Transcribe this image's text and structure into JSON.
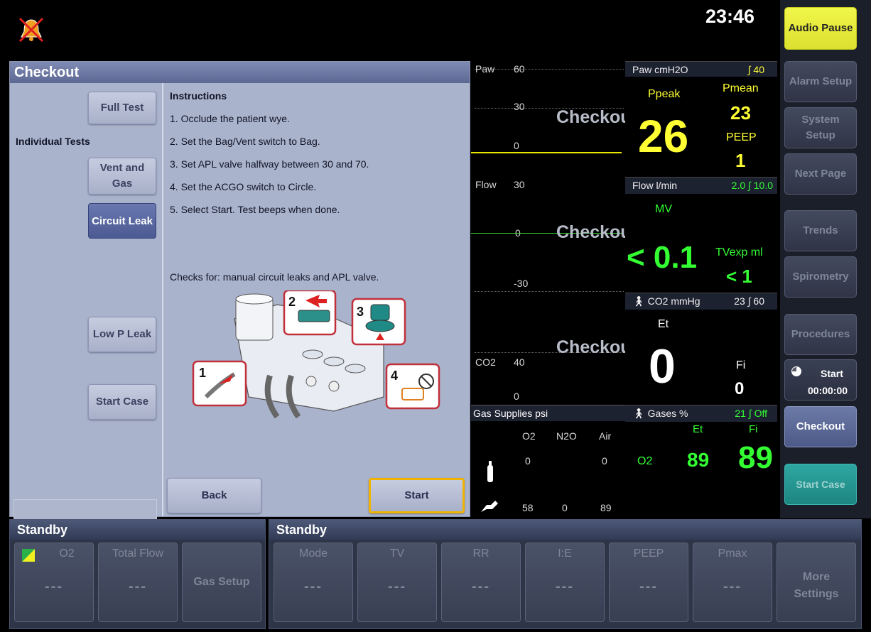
{
  "clock": "23:46",
  "checkout": {
    "title": "Checkout",
    "full_test": "Full Test",
    "individual_tests": "Individual Tests",
    "vent_and_gas": "Vent and Gas",
    "circuit_leak": "Circuit Leak",
    "low_p_leak": "Low P Leak",
    "start_case": "Start Case",
    "instructions_title": "Instructions",
    "steps": [
      "1. Occlude the patient wye.",
      "2. Set the Bag/Vent switch to Bag.",
      "3. Set APL valve halfway between 30 and 70.",
      "4. Set the ACGO switch to Circle.",
      "5. Select Start. Test beeps when done."
    ],
    "checks_for": "Checks for: manual circuit leaks and APL valve.",
    "diagram_numbers": [
      "1",
      "2",
      "3",
      "4"
    ],
    "back": "Back",
    "start": "Start"
  },
  "waves": {
    "paw_label": "Paw",
    "paw_scale": [
      "60",
      "30",
      "0"
    ],
    "flow_label": "Flow",
    "flow_scale": [
      "30",
      "0",
      "-30"
    ],
    "co2_label": "CO2",
    "co2_scale": [
      "40",
      "0"
    ],
    "overlay": "Checkout"
  },
  "gas_supplies": {
    "title": "Gas Supplies psi",
    "cols": [
      "O2",
      "N2O",
      "Air"
    ],
    "cyl_row": [
      "0",
      "",
      "0"
    ],
    "pipe_row": [
      "58",
      "0",
      "89"
    ]
  },
  "paw": {
    "header": "Paw cmH2O",
    "limit": "∫ 40",
    "ppeak_label": "Ppeak",
    "ppeak": "26",
    "pmean_label": "Pmean",
    "pmean": "23",
    "peep_label": "PEEP",
    "peep": "1"
  },
  "flow": {
    "header": "Flow l/min",
    "limit": "2.0 ∫ 10.0",
    "mv_label": "MV",
    "mv": "< 0.1",
    "tvexp_label": "TVexp ml",
    "tvexp": "< 1"
  },
  "co2": {
    "header": "CO2 mmHg",
    "limit": "23 ∫ 60",
    "et_label": "Et",
    "et": "0",
    "fi_label": "Fi",
    "fi": "0"
  },
  "gases": {
    "header": "Gases %",
    "limit": "21 ∫ Off",
    "et_label": "Et",
    "fi_label": "Fi",
    "o2_label": "O2",
    "o2_et": "89",
    "o2_fi": "89"
  },
  "right_buttons": {
    "audio_pause": "Audio Pause",
    "alarm_setup": "Alarm Setup",
    "system_setup": "System Setup",
    "next_page": "Next Page",
    "trends": "Trends",
    "spirometry": "Spirometry",
    "procedures": "Procedures",
    "timer_label": "Start",
    "timer_value": "00:00:00",
    "checkout": "Checkout",
    "start_case": "Start Case"
  },
  "standby_left": {
    "title": "Standby",
    "o2_label": "O2",
    "o2_value": "---",
    "total_flow_label": "Total Flow",
    "total_flow_value": "---",
    "gas_setup": "Gas Setup"
  },
  "standby_right": {
    "title": "Standby",
    "mode_label": "Mode",
    "mode_value": "---",
    "tv_label": "TV",
    "tv_value": "---",
    "rr_label": "RR",
    "rr_value": "---",
    "ie_label": "I:E",
    "ie_value": "---",
    "peep_label": "PEEP",
    "peep_value": "---",
    "pmax_label": "Pmax",
    "pmax_value": "---",
    "more_settings": "More Settings"
  },
  "colors": {
    "audio_pause_bg": "#e8ef3a",
    "paw_values": "#ffff33",
    "flow_values": "#33ff33",
    "checkout_panel": "#aab3cc",
    "start_outline": "#f0b400"
  }
}
